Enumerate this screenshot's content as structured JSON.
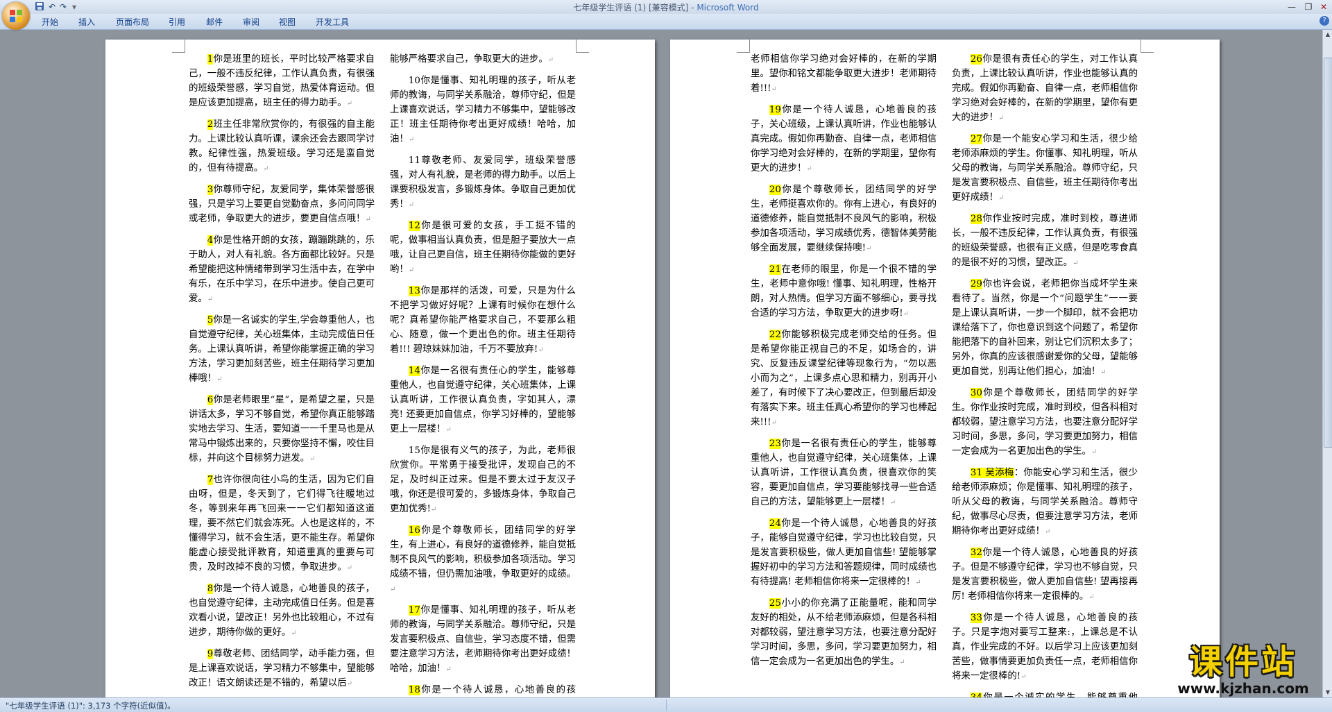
{
  "window": {
    "title": "七年级学生评语 (1) [兼容模式] - ",
    "app": "Microsoft Word"
  },
  "qat": {
    "undo": "↶",
    "redo": "↷",
    "customize": "▾"
  },
  "window_buttons": {
    "minimize": "—",
    "restore": "❐",
    "close": "✕"
  },
  "ribbon_tabs": [
    "开始",
    "插入",
    "页面布局",
    "引用",
    "邮件",
    "审阅",
    "视图",
    "开发工具"
  ],
  "help": "?",
  "paragraph_mark": "↵",
  "page1": {
    "left": [
      {
        "num": "1",
        "text": "你是班里的班长，平时比较严格要求自己，一般不违反纪律，工作认真负责，有很强的班级荣誉感，学习自觉，热爱体育运动。但是应该更加提高，班主任的得力助手。"
      },
      {
        "num": "2",
        "text": "班主任非常欣赏你的，有很强的自主能力。上课比较认真听课，课余还会去跟同学讨教。纪律性强，热爱班级。学习还是蛮自觉的，但有待提高。"
      },
      {
        "num": "3",
        "text": "你尊师守纪，友爱同学，集体荣誉感很强，只是学习上要更自觉勤奋点，多问问同学或老师，争取更大的进步，要更自信点哦！"
      },
      {
        "num": "4",
        "text": "你是性格开朗的女孩，蹦蹦跳跳的，乐于助人，对人有礼貌。各方面都比较好。只是希望能把这种情绪带到学习生活中去，在学中有乐，在乐中学习，在乐中进步。使自己更可爱。"
      },
      {
        "num": "5",
        "text": "你是一名诚实的学生,学会尊重他人，也自觉遵守纪律，关心班集体，主动完成值日任务。上课认真听讲，希望你能掌握正确的学习方法，学习更加刻苦些，班主任期待学习更加棒哦！"
      },
      {
        "num": "6",
        "text": "你是老师眼里“星”，是希望之星，只是讲话太多，学习不够自觉，希望你真正能够踏实地去学习、生活，要知道一一千里马也是从常马中锻炼出来的，只要你坚持不懈，咬住目标，并向这个目标努力进发。"
      },
      {
        "num": "7",
        "text": "也许你很向往小鸟的生活，因为它们自由呀，但是，冬天到了，它们得飞往暖地过冬，等到来年再飞回来一一它们都知道这道理，要不然它们就会冻死。人也是这样的，不懂得学习，就不会生活，更不能生存。希望你能虚心接受批评教育，知道重真的重要与可贵，及时改掉不良的习惯，争取进步。"
      },
      {
        "num": "8",
        "text": "你是一个待人诚恳，心地善良的孩子，也自觉遵守纪律，主动完成值日任务。但是喜欢看小说，望改正！另外也比较粗心，不过有进步，期待你做的更好。"
      },
      {
        "num": "9",
        "text": "尊敬老师、团结同学，动手能力强，但是上课喜欢说话，学习精力不够集中，望能够改正！语文朗读还是不错的，希望以后"
      }
    ],
    "right": [
      {
        "num": "",
        "text": "能够严格要求自己，争取更大的进步。"
      },
      {
        "num": "10",
        "plain": true,
        "text": "你是懂事、知礼明理的孩子，听从老师的教诲，与同学关系融洽，尊师守纪，但是上课喜欢说话，学习精力不够集中，望能够改正！班主任期待你考出更好成绩！哈哈，加油！"
      },
      {
        "num": "11",
        "plain": true,
        "text": "尊敬老师、友爱同学，班级荣誉感强，对人有礼貌，是老师的得力助手。以后上课要积极发言，多锻炼身体。争取自己更加优秀！"
      },
      {
        "num": "12",
        "text": "你是很可爱的女孩，手工挺不错的呢，做事相当认真负责，但是胆子要放大一点哦，让自己更自信，班主任期待你能做的更好哟！"
      },
      {
        "num": "13",
        "text": "你是那样的活泼，可爱，只是为什么不把学习做好好呢？上课有时候你在想什么呢？真希望你能严格要求自己，不要那么粗心、随意，做一个更出色的你。班主任期待着!!! 碧琼妹妹加油，千万不要放弃!"
      },
      {
        "num": "14",
        "text": "你是一名很有责任心的学生，能够尊重他人，也自觉遵守纪律，关心班集体，上课认真听讲，工作很认真负责，字如其人，漂亮! 还要更加自信点，你学习好棒的，望能够更上一层楼！"
      },
      {
        "num": "15",
        "plain": true,
        "text": "你是很有义气的孩子，为此，老师很欣赏你。平常勇于接受批评，发现自己的不足，及时纠正过来。但是不要太过于友汉子哦，你还是很可爱的，多锻炼身体，争取自己更加优秀!"
      },
      {
        "num": "16",
        "text": "你是个尊敬师长，团结同学的好学生，有上进心，有良好的道德修养，能自觉抵制不良风气的影响，积极参加各项活动。学习成绩不错，但仍需加油哦，争取更好的成绩。"
      },
      {
        "num": "17",
        "text": "你是懂事、知礼明理的孩子，听从老师的教诲，与同学关系融洽。尊师守纪，只是发言要积极点、自信些，学习态度不错，但需要注意学习方法，老师期待你考出更好成绩！哈哈，加油！"
      },
      {
        "num": "18",
        "text": "你是一个待人诚恳，心地善良的孩子，关心班级，上课比较认真听讲，作业也能够认真完成。假如你再勤奋、自律一点，"
      }
    ]
  },
  "page2": {
    "left": [
      {
        "num": "",
        "text": "老师相信你学习绝对会好棒的，在新的学期里。望你和铭文都能争取更大进步！老师期待着!!!"
      },
      {
        "num": "19",
        "text": "你是一个待人诚恳，心地善良的孩子，关心班级，上课认真听讲，作业也能够认真完成。假如你再勤奋、自律一点，老师相信你学习绝对会好棒的，在新的学期里，望你有更大的进步！"
      },
      {
        "num": "20",
        "text": "你是个尊敬师长，团结同学的好学生，老师挺喜欢你的。你有上进心，有良好的道德修养，能自觉抵制不良风气的影响，积极参加各项活动，学习成绩优秀，德智体美劳能够全面发展，要继续保持噢!"
      },
      {
        "num": "21",
        "text": "在老师的眼里，你是一个很不错的学生，老师中意你哦! 懂事、知礼明理，性格开朗，对人热情。但学习方面不够细心，要寻找合适的学习方法，争取更大的进步呀!"
      },
      {
        "num": "22",
        "text": "你能够积极完成老师交给的任务。但是希望你能正视自己的不足，如场合的，讲究、反复违反课堂纪律等现象行为，“勿以恶小而为之”，上课多点心思和精力，别再开小差了，有时候下了决心要改正，但到最后却没有落实下来。班主任真心希望你的学习也棒起来!!!"
      },
      {
        "num": "23",
        "text": "你是一名很有责任心的学生，能够尊重他人，也自觉遵守纪律，关心班集体，上课认真听讲，工作很认真负责，很喜欢你的笑容，要更加自信点，学习要能够找寻一些合适自己的方法，望能够更上一层楼！"
      },
      {
        "num": "24",
        "text": "你是一个待人诚恳，心地善良的好孩子，能够自觉遵守纪律，学习也比较自觉，只是发言要积极些，做人更加自信些! 望能够掌握好初中的学习方法和答题规律，同时成绩也有待提高! 老师相信你将来一定很棒的！"
      },
      {
        "num": "25",
        "text": "小小的你充满了正能量呢，能和同学友好的相处，从不给老师添麻烦，但是各科相对都较弱，望注意学习方法，也要注意分配好学习时间，多思，多问，学习要更加努力，相信一定会成为一名更加出色的学生。"
      }
    ],
    "right": [
      {
        "num": "26",
        "text": "你是很有责任心的学生，对工作认真负责，上课比较认真听讲，作业也能够认真的完成。假如你再勤奋、自律一点，老师相信你学习绝对会好棒的，在新的学期里，望你有更大的进步！"
      },
      {
        "num": "27",
        "text": "你是一个能安心学习和生活，很少给老师添麻烦的学生。你懂事、知礼明理，听从父母的教诲，与同学关系融洽。尊师守纪，只是发言要积极点、自信些，班主任期待你考出更好成绩！"
      },
      {
        "num": "28",
        "text": "你作业按时完成，准时到校，尊进师长，一般不违反纪律，工作认真负责，有很强的班级荣誉感，也很有正义感，但是吃零食真的是很不好的习惯，望改正。"
      },
      {
        "num": "29",
        "text": "你也许会说，老师把你当成坏学生来看待了。当然，你是一个“问题学生”一一要是上课认真听讲，一步一个脚印，就不会把功课给落下了，你也意识到这个问题了，希望你能把落下的自补回来，别让它们沉积太多了；另外，你真的应该很感谢爱你的父母，望能够更加自觉，别再让他们担心，加油！"
      },
      {
        "num": "30",
        "text": "你是个尊敬师长，团结同学的好学生。你作业按时完成，准时到校，但各科相对都较弱，望注意学习方法，也要注意分配好学习时间，多思，多问，学习要更加努力，相信一定会成为一名更加出色的学生。"
      },
      {
        "num": "31 吴添梅",
        "text": "：你能安心学习和生活，很少给老师添麻烦；你是懂事、知礼明理的孩子，听从父母的教诲，与同学关系融洽。尊师守纪，做事尽心尽责，但要注意学习方法，老师期待你考出更好成绩！"
      },
      {
        "num": "32",
        "text": "你是一个待人诚恳，心地善良的好孩子。但是不够遵守纪律，学习也不够自觉，只是发言要积极些，做人更加自信些! 望再接再厉! 老师相信你将来一定很棒的。"
      },
      {
        "num": "33",
        "text": "你是一个待人诚恳，心地善良的孩子。只是字炮对要写工整来:，上课总是不认真，作业完成的不好。以后学习上应该更加刻苦些，做事情要更加负责任一点，老师相信你将来一定很棒的!"
      },
      {
        "num": "34",
        "text": "你是一个诚实的学生，能够尊重他人，也自觉遵守纪律，关心班集体，主动完"
      }
    ]
  },
  "status": "\"七年级学生评语 (1)\": 3,173 个字符(近似值)。",
  "watermark": {
    "main": "课件站",
    "url": "www.kjzhan.com"
  }
}
